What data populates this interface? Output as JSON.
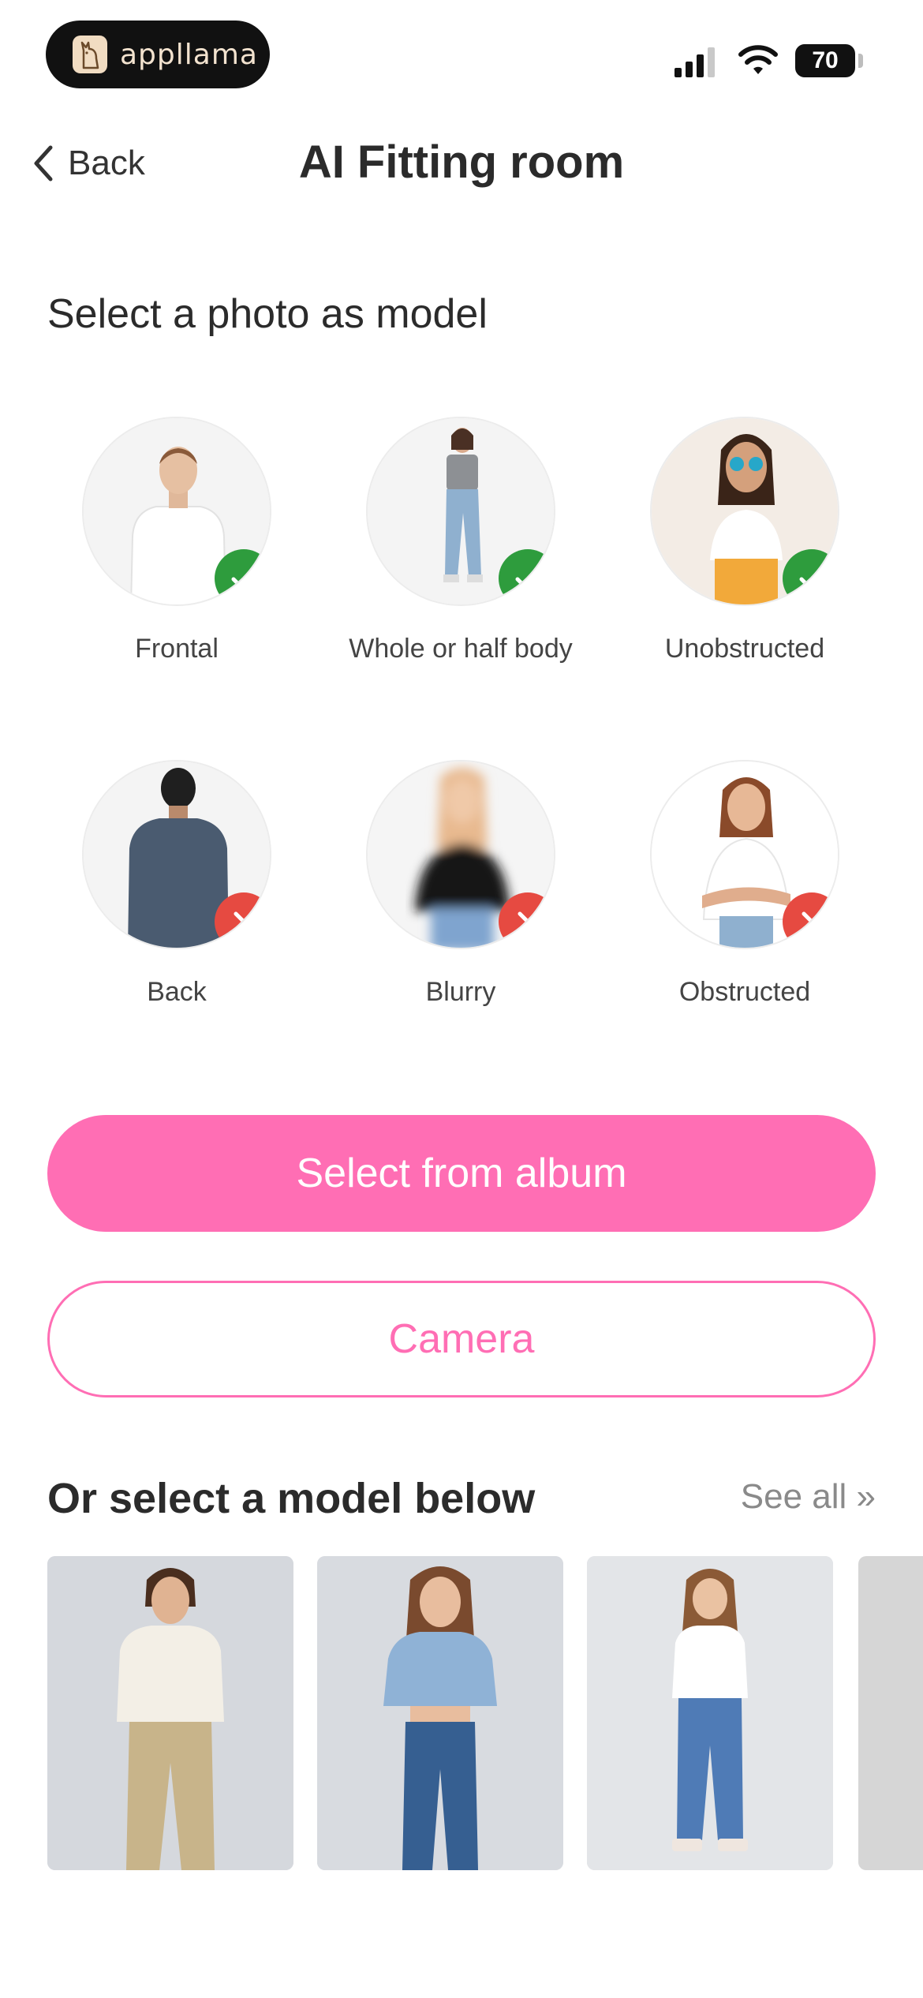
{
  "status_bar": {
    "app_name": "appllama",
    "battery": "70"
  },
  "header": {
    "back_label": "Back",
    "title": "AI Fitting room"
  },
  "section_title": "Select a photo as model",
  "guides": [
    {
      "label": "Frontal",
      "status": "good"
    },
    {
      "label": "Whole or half body",
      "status": "good"
    },
    {
      "label": "Unobstructed",
      "status": "good"
    },
    {
      "label": "Back",
      "status": "bad"
    },
    {
      "label": "Blurry",
      "status": "bad"
    },
    {
      "label": "Obstructed",
      "status": "bad"
    }
  ],
  "buttons": {
    "album": "Select from album",
    "camera": "Camera"
  },
  "models": {
    "title": "Or select a model below",
    "see_all": "See all »"
  },
  "colors": {
    "accent": "#ff6eb4",
    "good": "#2e9c3d",
    "bad": "#e64a41"
  }
}
